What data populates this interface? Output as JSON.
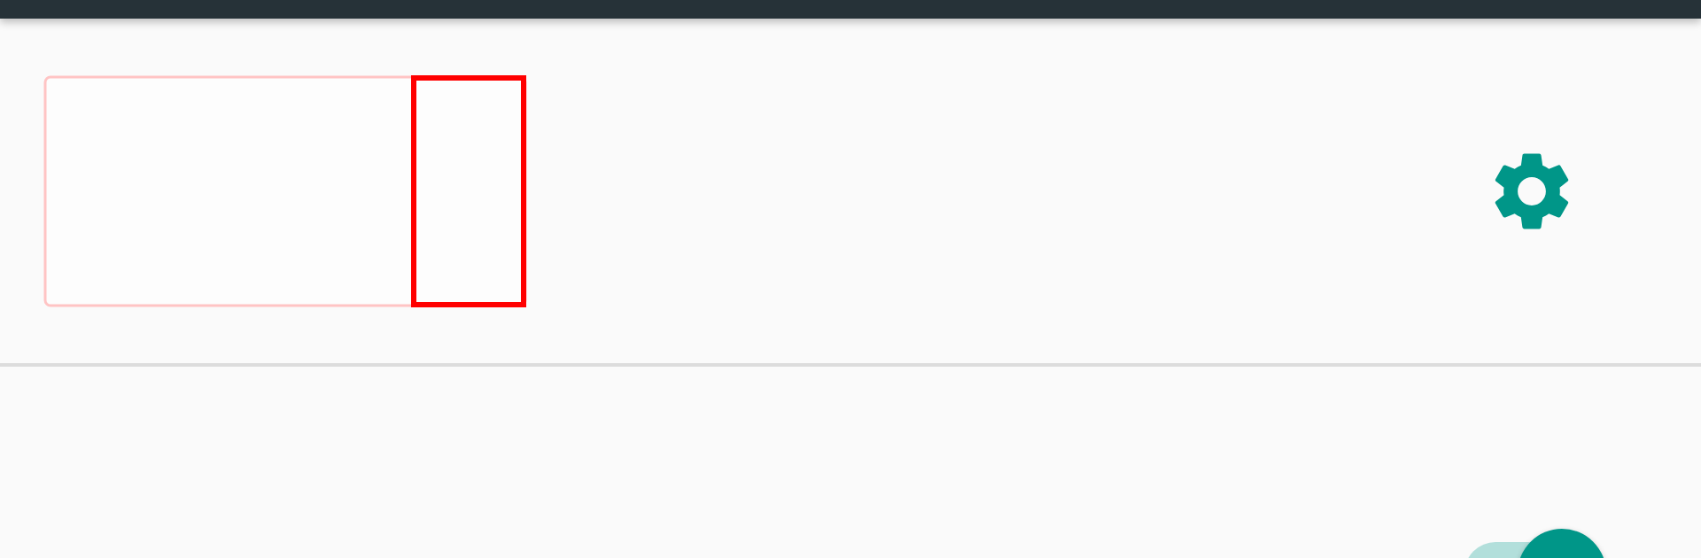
{
  "toggle_switch": {
    "on": true
  }
}
